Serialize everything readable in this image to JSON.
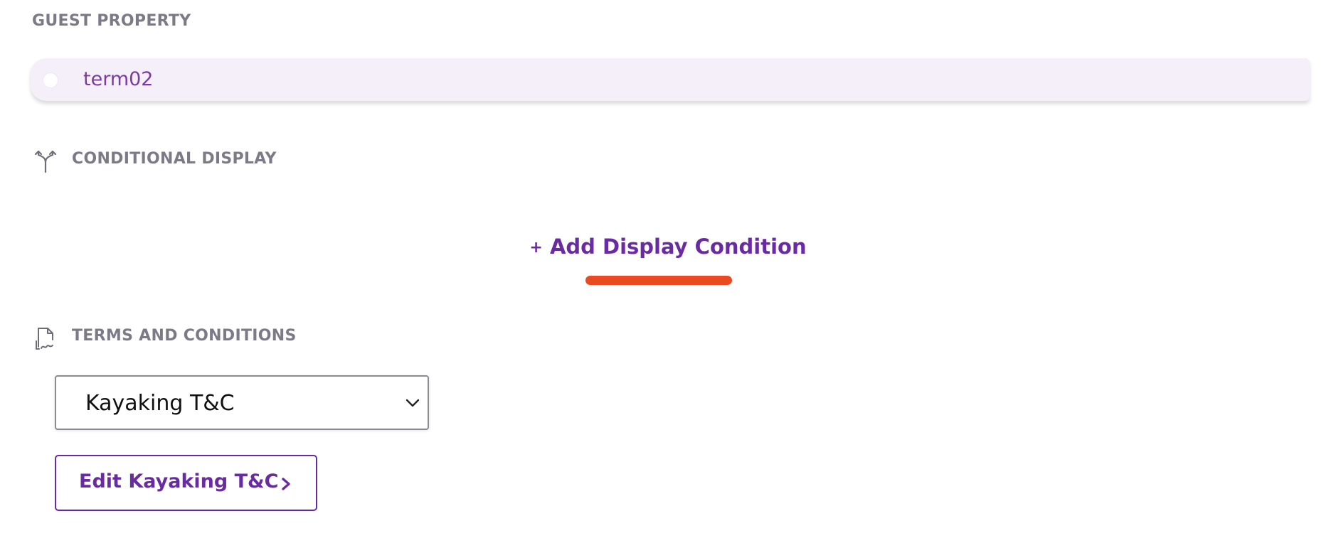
{
  "guest_property": {
    "heading": "GUEST PROPERTY",
    "chip_label": "term02"
  },
  "conditional_display": {
    "heading": "CONDITIONAL DISPLAY",
    "icon": "split-arrows-icon",
    "add_plus": "+",
    "add_label": "Add Display Condition",
    "annotation_color": "#e94a22"
  },
  "terms": {
    "heading": "TERMS AND CONDITIONS",
    "icon": "document-signature-icon",
    "selected_value": "Kayaking T&C",
    "edit_button_label": "Edit Kayaking T&C"
  },
  "colors": {
    "accent": "#6a2aa3",
    "heading": "#7c7a87",
    "chip_background": "#f4eff9"
  }
}
